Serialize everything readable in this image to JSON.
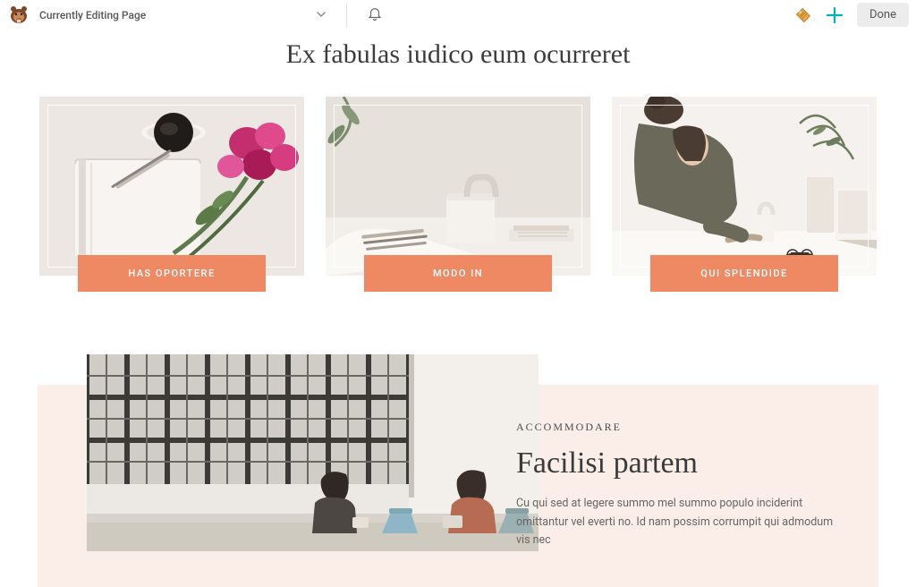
{
  "topbar": {
    "page_title": "Currently Editing Page",
    "done_label": "Done"
  },
  "hero": {
    "heading": "Ex fabulas iudico eum ocurreret"
  },
  "cards": [
    {
      "button": "HAS OPORTERE"
    },
    {
      "button": "MODO IN"
    },
    {
      "button": "QUI SPLENDIDE"
    }
  ],
  "feature": {
    "eyebrow": "ACCOMMODARE",
    "title": "Facilisi partem",
    "body": "Cu qui sed at legere summo mel summo populo inciderint omittantur vel everti no. Id nam possim corrumpit qui admodum vis nec"
  },
  "colors": {
    "accent": "#ee8964",
    "teal": "#00b2b8",
    "feature_bg": "#fbeee9"
  }
}
